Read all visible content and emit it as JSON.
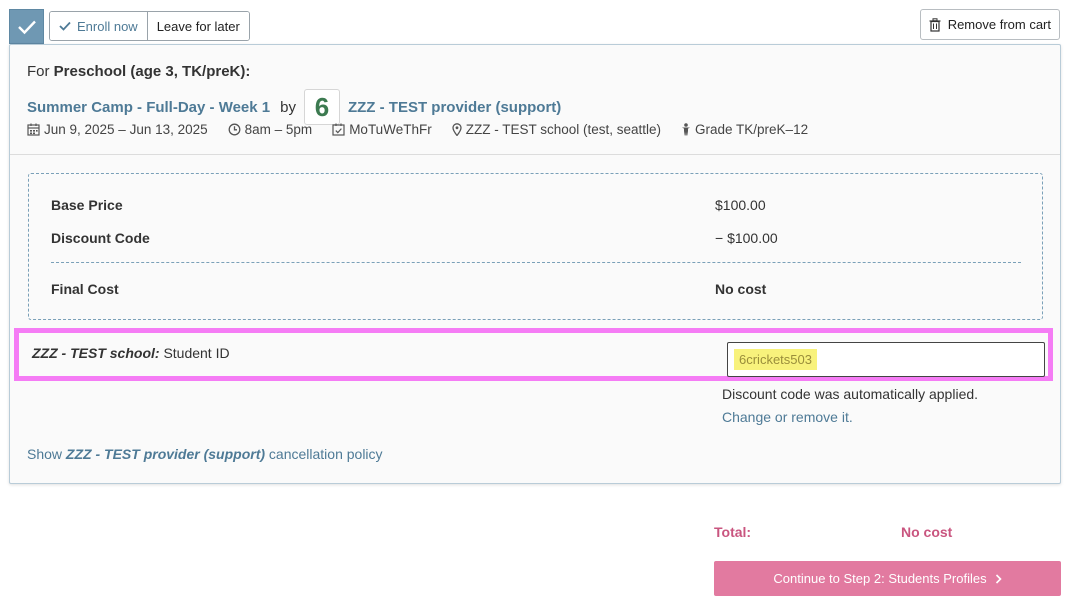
{
  "top_bar": {
    "enroll_label": "Enroll now",
    "later_label": "Leave for later",
    "remove_label": "Remove from cart"
  },
  "card": {
    "for_prefix": "For",
    "for_group": "Preschool (age 3, TK/preK):",
    "program_title": "Summer Camp - Full-Day - Week 1",
    "by_text": "by",
    "provider_logo_char": "6",
    "provider_name": "ZZZ - TEST provider (support)",
    "meta": {
      "dates": "Jun 9, 2025 – Jun 13, 2025",
      "time": "8am – 5pm",
      "days": "MoTuWeThFr",
      "location": "ZZZ - TEST school (test, seattle)",
      "grade": "Grade TK/preK–12"
    },
    "pricing": {
      "base_label": "Base Price",
      "base_value": "$100.00",
      "discount_label": "Discount Code",
      "discount_value": "− $100.00",
      "final_label": "Final Cost",
      "final_value": "No cost"
    },
    "student_id": {
      "school_label": "ZZZ - TEST school:",
      "field_label": "Student ID",
      "value": "6crickets503"
    },
    "discount_note": "Discount code was automatically applied.",
    "change_link": "Change or remove it.",
    "cancellation": {
      "prefix": "Show",
      "provider": "ZZZ - TEST provider (support)",
      "suffix": "cancellation policy"
    }
  },
  "totals": {
    "label": "Total:",
    "value": "No cost"
  },
  "continue_label": "Continue to Step 2: Students Profiles",
  "colors": {
    "accent_blue": "#4e7a96",
    "check_bg": "#6f98b3",
    "pink": "#e27aa0",
    "highlight_border": "#f57cf5",
    "code_highlight": "#f8f27c"
  }
}
